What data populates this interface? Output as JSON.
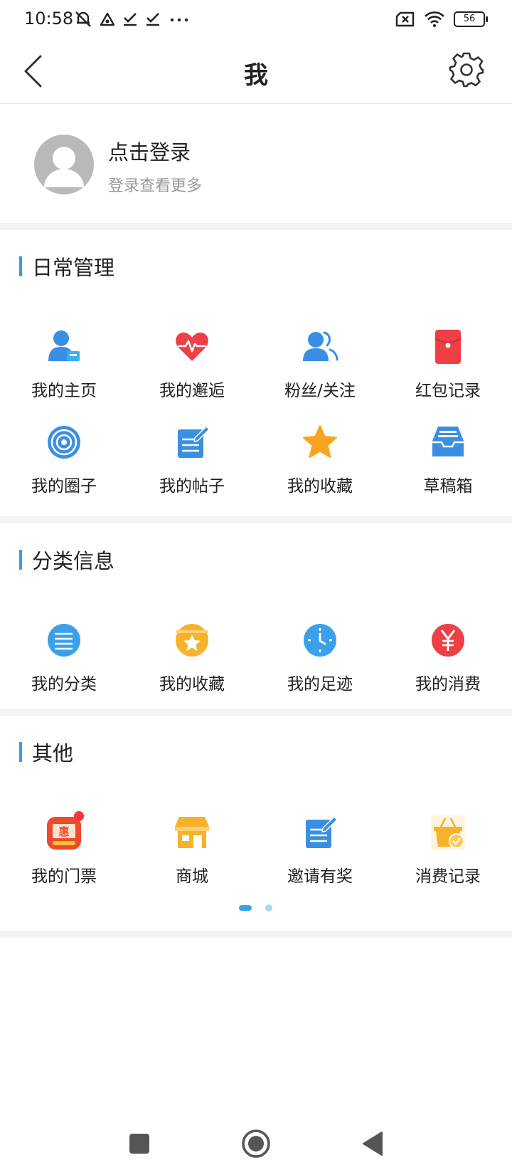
{
  "status_bar": {
    "time": "10:58",
    "battery": "56",
    "icons": [
      "mute-bell-icon",
      "app-triangle-icon",
      "check-download-icon",
      "check-download-icon",
      "more-dots-icon",
      "sim-x-icon",
      "wifi-icon",
      "battery-icon"
    ]
  },
  "header": {
    "title": "我",
    "back_icon": "back-chevron-icon",
    "settings_icon": "gear-icon"
  },
  "login": {
    "title": "点击登录",
    "subtitle": "登录查看更多"
  },
  "sections": {
    "daily": {
      "title": "日常管理",
      "items": [
        {
          "label": "我的主页",
          "icon": "user-home-icon"
        },
        {
          "label": "我的邂逅",
          "icon": "heart-pulse-icon"
        },
        {
          "label": "粉丝/关注",
          "icon": "users-icon"
        },
        {
          "label": "红包记录",
          "icon": "red-envelope-icon"
        },
        {
          "label": "我的圈子",
          "icon": "circle-target-icon"
        },
        {
          "label": "我的帖子",
          "icon": "note-edit-icon"
        },
        {
          "label": "我的收藏",
          "icon": "star-icon"
        },
        {
          "label": "草稿箱",
          "icon": "inbox-tray-icon"
        }
      ]
    },
    "classify": {
      "title": "分类信息",
      "items": [
        {
          "label": "我的分类",
          "icon": "list-circle-icon"
        },
        {
          "label": "我的收藏",
          "icon": "star-circle-icon"
        },
        {
          "label": "我的足迹",
          "icon": "clock-icon"
        },
        {
          "label": "我的消费",
          "icon": "yen-icon"
        }
      ]
    },
    "other": {
      "title": "其他",
      "items": [
        {
          "label": "我的门票",
          "icon": "ticket-icon",
          "badge": true
        },
        {
          "label": "商城",
          "icon": "shop-icon"
        },
        {
          "label": "邀请有奖",
          "icon": "invite-edit-icon"
        },
        {
          "label": "消费记录",
          "icon": "basket-check-icon"
        }
      ]
    }
  },
  "pager": {
    "pages": 2,
    "active": 1
  },
  "nav_bar": {
    "icons": [
      "recents-square-icon",
      "home-circle-icon",
      "back-triangle-icon"
    ]
  }
}
